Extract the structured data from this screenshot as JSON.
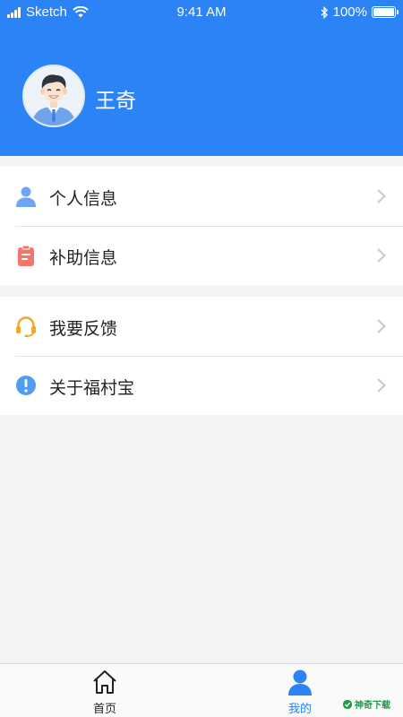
{
  "status_bar": {
    "carrier": "Sketch",
    "time": "9:41 AM",
    "battery": "100%",
    "battery_level": 1.0
  },
  "profile": {
    "name": "王奇",
    "avatar_icon": "user-avatar-icon"
  },
  "menu": {
    "group1": [
      {
        "label": "个人信息",
        "icon": "person-icon",
        "color": "#6fa6f2"
      },
      {
        "label": "补助信息",
        "icon": "clipboard-icon",
        "color": "#f0776a"
      }
    ],
    "group2": [
      {
        "label": "我要反馈",
        "icon": "headset-icon",
        "color": "#f6a623"
      },
      {
        "label": "关于福村宝",
        "icon": "info-icon",
        "color": "#4f9cf0"
      }
    ]
  },
  "tabbar": {
    "home": {
      "label": "首页",
      "icon": "home-icon"
    },
    "me": {
      "label": "我的",
      "icon": "person-icon",
      "active": true
    }
  },
  "watermark": {
    "text": "神奇下载"
  },
  "colors": {
    "primary": "#2b83f5",
    "background": "#f4f4f4",
    "text": "#222222"
  }
}
